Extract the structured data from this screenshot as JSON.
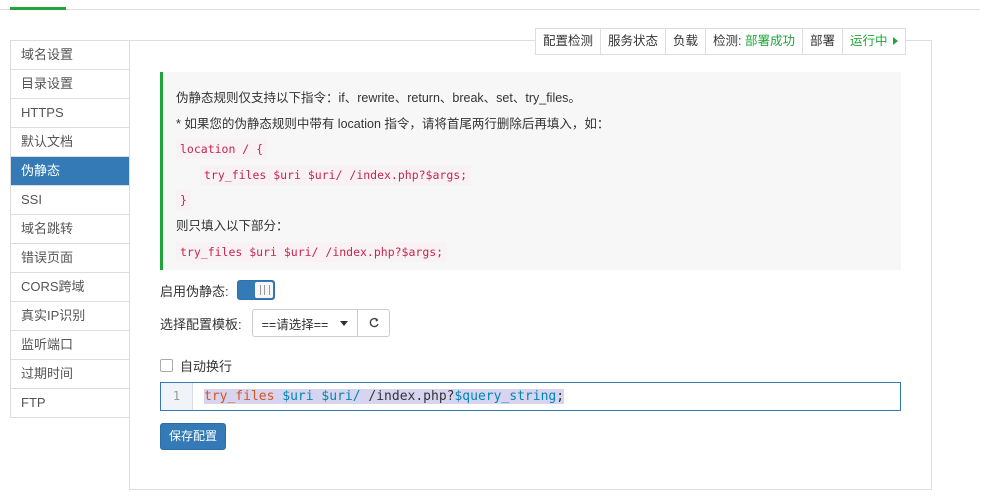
{
  "sidebar": {
    "items": [
      {
        "label": "域名设置"
      },
      {
        "label": "目录设置"
      },
      {
        "label": "HTTPS"
      },
      {
        "label": "默认文档"
      },
      {
        "label": "伪静态"
      },
      {
        "label": "SSI"
      },
      {
        "label": "域名跳转"
      },
      {
        "label": "错误页面"
      },
      {
        "label": "CORS跨域"
      },
      {
        "label": "真实IP识别"
      },
      {
        "label": "监听端口"
      },
      {
        "label": "过期时间"
      },
      {
        "label": "FTP"
      }
    ],
    "active_index": 4
  },
  "status_bar": {
    "config_check": "配置检测",
    "service_status": "服务状态",
    "load": "负载",
    "check_label": "检测:",
    "check_result": "部署成功",
    "deploy": "部署",
    "running": "运行中"
  },
  "tips": {
    "line1": "伪静态规则仅支持以下指令：if、rewrite、return、break、set、try_files。",
    "line2": "* 如果您的伪静态规则中带有 location 指令，请将首尾两行删除后再填入，如：",
    "code1": "location / {",
    "code2": "try_files $uri $uri/ /index.php?$args;",
    "code3": "}",
    "line3": "则只填入以下部分：",
    "code4": "try_files $uri $uri/ /index.php?$args;"
  },
  "form": {
    "enable_label": "启用伪静态:",
    "enable_on": true,
    "template_label": "选择配置模板:",
    "template_selected": "==请选择==",
    "auto_wrap_label": "自动换行",
    "auto_wrap_checked": false
  },
  "editor": {
    "line_number": "1",
    "tokens": {
      "kw": "try_files",
      "v1": "$uri",
      "v2": "$uri/",
      "path": "/index.php?",
      "v3": "$query_string",
      "end": ";"
    }
  },
  "save_label": "保存配置",
  "colors": {
    "accent_blue": "#337ab7",
    "success_green": "#20a53a",
    "code_red": "#c7254e"
  }
}
